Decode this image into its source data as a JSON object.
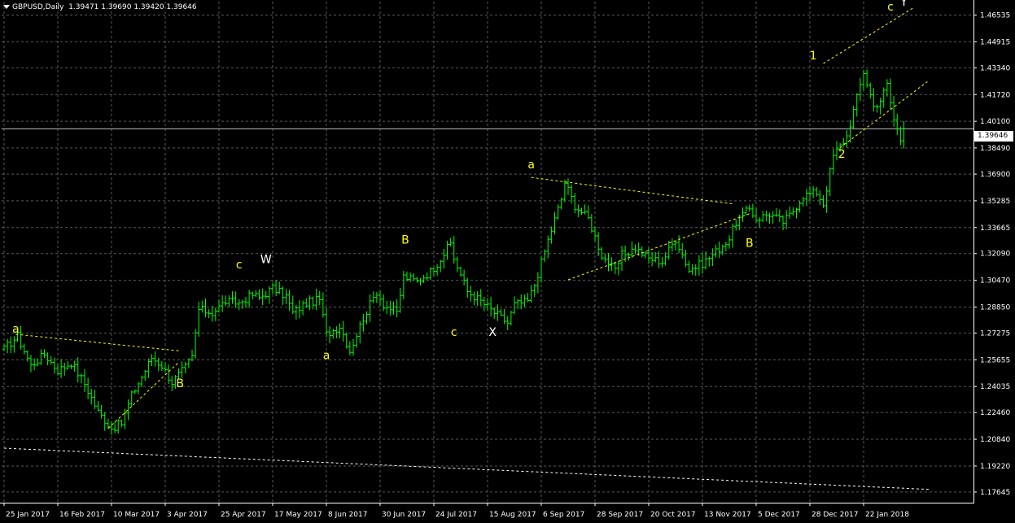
{
  "header": {
    "symbol": "GBPUSD,Daily",
    "ohlc": "1.39471 1.39690 1.39420 1.39646"
  },
  "current_price_label": "1.39646",
  "colors": {
    "background": "#000000",
    "grid": "#5a5a5a",
    "bull_bar": "#00ff00",
    "trendline": "#ffff00",
    "wave_label": "#ffff00",
    "wave_label_major": "#ffffff",
    "price_line": "#c0c0c0"
  },
  "chart_data": {
    "type": "candlestick",
    "symbol": "GBPUSD",
    "timeframe": "Daily",
    "ylim": [
      1.17,
      1.4735
    ],
    "y_ticks": [
      1.46535,
      1.44915,
      1.4334,
      1.4172,
      1.401,
      1.3849,
      1.369,
      1.35285,
      1.33665,
      1.3209,
      1.3047,
      1.2885,
      1.27275,
      1.25655,
      1.24035,
      1.2246,
      1.2084,
      1.1922,
      1.17645
    ],
    "y_tick_labels": [
      "1.46535",
      "1.44915",
      "1.43340",
      "1.41720",
      "1.40100",
      "1.38490",
      "1.36900",
      "1.35285",
      "1.33665",
      "1.32090",
      "1.30470",
      "1.28850",
      "1.27275",
      "1.25655",
      "1.24035",
      "1.22460",
      "1.20840",
      "1.19220",
      "1.17645"
    ],
    "x_tick_labels": [
      "25 Jan 2017",
      "16 Feb 2017",
      "10 Mar 2017",
      "3 Apr 2017",
      "25 Apr 2017",
      "17 May 2017",
      "8 Jun 2017",
      "30 Jun 2017",
      "24 Jul 2017",
      "15 Aug 2017",
      "6 Sep 2017",
      "28 Sep 2017",
      "20 Oct 2017",
      "13 Nov 2017",
      "5 Dec 2017",
      "28 Dec 2017",
      "22 Jan 2018"
    ],
    "x_tick_index": [
      0,
      16,
      32,
      48,
      64,
      80,
      96,
      112,
      128,
      144,
      160,
      176,
      192,
      208,
      224,
      240,
      256
    ],
    "current_price": 1.39646,
    "close_path": [
      [
        0,
        1.263
      ],
      [
        4,
        1.271
      ],
      [
        8,
        1.253
      ],
      [
        12,
        1.26
      ],
      [
        16,
        1.25
      ],
      [
        20,
        1.255
      ],
      [
        24,
        1.242
      ],
      [
        28,
        1.225
      ],
      [
        32,
        1.215
      ],
      [
        35,
        1.218
      ],
      [
        38,
        1.235
      ],
      [
        42,
        1.25
      ],
      [
        44,
        1.258
      ],
      [
        47,
        1.253
      ],
      [
        50,
        1.243
      ],
      [
        54,
        1.252
      ],
      [
        56,
        1.258
      ],
      [
        58,
        1.287
      ],
      [
        62,
        1.285
      ],
      [
        66,
        1.292
      ],
      [
        70,
        1.291
      ],
      [
        74,
        1.296
      ],
      [
        76,
        1.294
      ],
      [
        80,
        1.3
      ],
      [
        84,
        1.295
      ],
      [
        86,
        1.285
      ],
      [
        90,
        1.291
      ],
      [
        94,
        1.293
      ],
      [
        96,
        1.272
      ],
      [
        100,
        1.277
      ],
      [
        103,
        1.262
      ],
      [
        107,
        1.282
      ],
      [
        111,
        1.298
      ],
      [
        113,
        1.29
      ],
      [
        117,
        1.285
      ],
      [
        119,
        1.307
      ],
      [
        123,
        1.304
      ],
      [
        127,
        1.31
      ],
      [
        129,
        1.315
      ],
      [
        133,
        1.327
      ],
      [
        134,
        1.318
      ],
      [
        138,
        1.298
      ],
      [
        142,
        1.292
      ],
      [
        146,
        1.285
      ],
      [
        150,
        1.279
      ],
      [
        152,
        1.29
      ],
      [
        156,
        1.292
      ],
      [
        158,
        1.302
      ],
      [
        162,
        1.329
      ],
      [
        166,
        1.354
      ],
      [
        167,
        1.364
      ],
      [
        170,
        1.35
      ],
      [
        174,
        1.342
      ],
      [
        178,
        1.32
      ],
      [
        182,
        1.31
      ],
      [
        184,
        1.32
      ],
      [
        188,
        1.324
      ],
      [
        192,
        1.318
      ],
      [
        196,
        1.316
      ],
      [
        200,
        1.33
      ],
      [
        204,
        1.311
      ],
      [
        208,
        1.315
      ],
      [
        212,
        1.322
      ],
      [
        216,
        1.33
      ],
      [
        218,
        1.34
      ],
      [
        222,
        1.348
      ],
      [
        224,
        1.342
      ],
      [
        228,
        1.345
      ],
      [
        232,
        1.34
      ],
      [
        234,
        1.344
      ],
      [
        238,
        1.356
      ],
      [
        242,
        1.358
      ],
      [
        244,
        1.351
      ],
      [
        247,
        1.38
      ],
      [
        251,
        1.392
      ],
      [
        254,
        1.415
      ],
      [
        256,
        1.431
      ],
      [
        259,
        1.41
      ],
      [
        261,
        1.414
      ],
      [
        263,
        1.423
      ],
      [
        265,
        1.402
      ],
      [
        267,
        1.39
      ],
      [
        268,
        1.3965
      ]
    ],
    "wave_labels": [
      {
        "text": "a",
        "x": 3.5,
        "y": 1.273
      },
      {
        "text": "B",
        "x": 52.4,
        "y": 1.24
      },
      {
        "text": "c",
        "x": 70,
        "y": 1.312
      },
      {
        "text": "W",
        "x": 78,
        "y": 1.315
      },
      {
        "text": "a",
        "x": 96,
        "y": 1.257
      },
      {
        "text": "B",
        "x": 119.5,
        "y": 1.327
      },
      {
        "text": "c",
        "x": 134,
        "y": 1.271
      },
      {
        "text": "X",
        "x": 145.5,
        "y": 1.271
      },
      {
        "text": "a",
        "x": 157,
        "y": 1.3725
      },
      {
        "text": "B",
        "x": 222,
        "y": 1.325
      },
      {
        "text": "1",
        "x": 241,
        "y": 1.4385
      },
      {
        "text": "2",
        "x": 249.5,
        "y": 1.379
      },
      {
        "text": "c",
        "x": 264,
        "y": 1.468
      },
      {
        "text": "Y",
        "x": 268,
        "y": 1.471
      }
    ],
    "trendlines": [
      {
        "style": "dashed",
        "color": "yellow",
        "points": [
          [
            3.5,
            1.272
          ],
          [
            52,
            1.262
          ]
        ]
      },
      {
        "style": "dashed",
        "color": "yellow",
        "points": [
          [
            31,
            1.215
          ],
          [
            52,
            1.255
          ]
        ]
      },
      {
        "style": "dashed",
        "color": "yellow",
        "points": [
          [
            157,
            1.367
          ],
          [
            217,
            1.351
          ]
        ]
      },
      {
        "style": "dashed",
        "color": "yellow",
        "points": [
          [
            168,
            1.305
          ],
          [
            222,
            1.345
          ]
        ]
      },
      {
        "style": "dashed",
        "color": "yellow",
        "points": [
          [
            244,
            1.436
          ],
          [
            271,
            1.47
          ]
        ]
      },
      {
        "style": "dashed",
        "color": "yellow",
        "points": [
          [
            249,
            1.385
          ],
          [
            275,
            1.425
          ]
        ]
      },
      {
        "style": "dashed",
        "color": "white",
        "points": [
          [
            0,
            1.203
          ],
          [
            276,
            1.178
          ]
        ]
      }
    ]
  }
}
